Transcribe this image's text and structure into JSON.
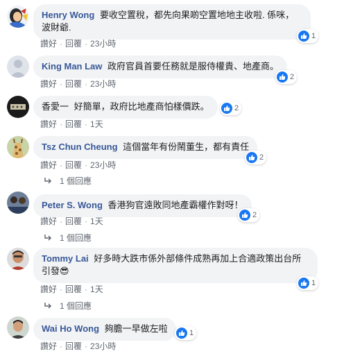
{
  "actions": {
    "like": "讚好",
    "reply": "回覆",
    "dot": "·"
  },
  "comments": [
    {
      "author": "Henry Wong",
      "text": "要收空置稅，都先向果啲空置地地主收啦. 係咪，波財爺.",
      "likes": "1",
      "time": "23小時"
    },
    {
      "author": "King Man Law",
      "text": "政府官員首要任務就是服侍權貴、地產商。",
      "likes": "2",
      "time": "23小時"
    },
    {
      "author": "香愛一",
      "text": "好簡單，政府比地產商怕樣價跌。",
      "likes": "2",
      "time": "1天"
    },
    {
      "author": "Tsz Chun Cheung",
      "text": "這個當年有份鬧董生，都有責任",
      "likes": "2",
      "time": "23小時",
      "replies": "1 個回應"
    },
    {
      "author": "Peter S. Wong",
      "text": "香港狗官遠敗同地產霸權作對呀！",
      "likes": "2",
      "time": "1天",
      "replies": "1 個回應"
    },
    {
      "author": "Tommy Lai",
      "text": "好多時大跌市係外部條件成熟再加上合適政策出台所引發😎",
      "likes": "1",
      "time": "1天",
      "replies": "1 個回應"
    },
    {
      "author": "Wai Ho Wong",
      "text": "夠膽一早做左啦",
      "likes": "1",
      "time": "23小時"
    }
  ],
  "colors": {
    "author": "#385898",
    "bubble": "#f2f3f5",
    "like": "#1877f2",
    "meta": "#606770"
  },
  "icons": {
    "like": "thumbs-up-icon",
    "reply": "reply-arrow-icon"
  }
}
